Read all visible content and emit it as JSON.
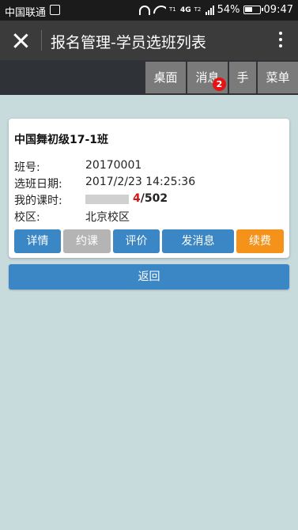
{
  "status_bar": {
    "carrier": "中国联通",
    "net_small_top": "T1",
    "net_label": "4G",
    "net_small_top2": "T2",
    "battery": "54%",
    "time": "09:47"
  },
  "title_bar": {
    "title": "报名管理-学员选班列表"
  },
  "top_nav": {
    "items": [
      {
        "label": "桌面"
      },
      {
        "label": "消息",
        "badge": "2"
      },
      {
        "label": "手"
      },
      {
        "label": "菜单"
      }
    ]
  },
  "card": {
    "class_name": "中国舞初级17-1班",
    "class_no_label": "班号:",
    "class_no": "20170001",
    "enroll_date_label": "选班日期:",
    "enroll_date": "2017/2/23 14:25:36",
    "hours_label": "我的课时:",
    "hours_used": "4",
    "hours_slash": "/",
    "hours_total": "502",
    "hours_progress": 0.008,
    "campus_label": "校区:",
    "campus": "北京校区",
    "buttons": [
      {
        "label": "详情"
      },
      {
        "label": "约课"
      },
      {
        "label": "评价"
      },
      {
        "label": "发消息"
      },
      {
        "label": "续费"
      }
    ]
  },
  "back_button": "返回",
  "colors": {
    "accent_blue": "#3b86c4",
    "disabled_gray": "#b4b4b4",
    "renew_orange": "#f4921a",
    "hours_red": "#d41515",
    "page_bg": "#c7dadc"
  }
}
